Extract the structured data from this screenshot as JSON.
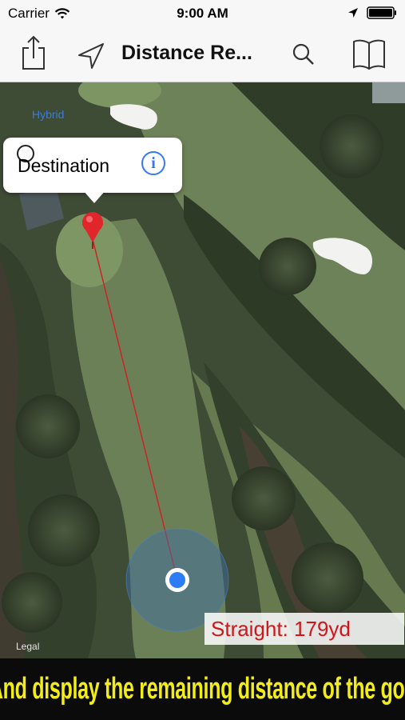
{
  "status_bar": {
    "carrier": "Carrier",
    "time": "9:00 AM"
  },
  "nav": {
    "title": "Distance Re...",
    "icons": [
      "share-icon",
      "location-arrow-icon",
      "search-icon",
      "book-icon"
    ]
  },
  "map": {
    "mode_label": "Hybrid",
    "legal_label": "Legal",
    "callout": {
      "title": "Destination",
      "info_glyph": "i"
    },
    "distance_text": "Straight: 179yd"
  },
  "banner": {
    "text": "And display the remaining distance of the golf"
  },
  "colors": {
    "accent": "#3478f6",
    "pin": "#e0252b",
    "distance_text": "#d0151b",
    "banner_text": "#f2ec1a"
  }
}
